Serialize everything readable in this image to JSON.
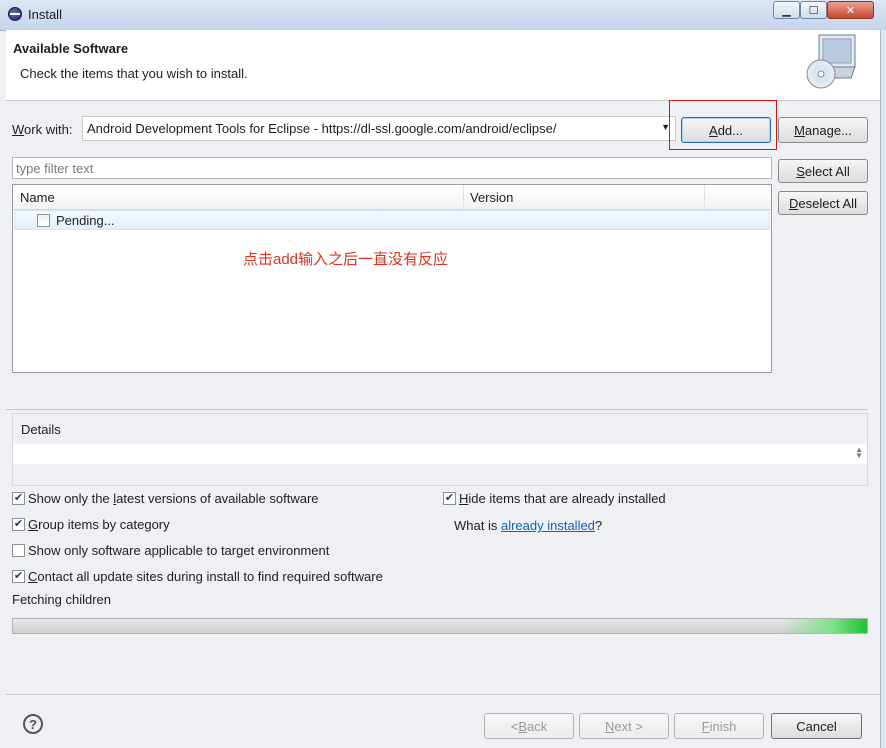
{
  "window": {
    "title": "Install"
  },
  "header": {
    "title": "Available Software",
    "description": "Check the items that you wish to install."
  },
  "work_with": {
    "label": "Work with:",
    "value": "Android Development Tools for Eclipse - https://dl-ssl.google.com/android/eclipse/",
    "add_label": "Add...",
    "manage_label": "Manage..."
  },
  "filter": {
    "placeholder": "type filter text"
  },
  "selection": {
    "select_all": "Select All",
    "deselect_all": "Deselect All"
  },
  "table": {
    "columns": [
      "Name",
      "Version"
    ],
    "rows": [
      {
        "name": "Pending..."
      }
    ]
  },
  "annotation": "点击add输入之后一直没有反应",
  "details": {
    "label": "Details"
  },
  "options": {
    "latest": {
      "label": "Show only the latest versions of available software",
      "checked": true
    },
    "group": {
      "label": "Group items by category",
      "checked": true
    },
    "target": {
      "label": "Show only software applicable to target environment",
      "checked": false
    },
    "contact": {
      "label": "Contact all update sites during install to find required software",
      "checked": true
    },
    "hide": {
      "label": "Hide items that are already installed",
      "checked": true
    }
  },
  "what_is": {
    "prefix": "What is ",
    "link": "already installed",
    "suffix": "?"
  },
  "status": "Fetching children",
  "progress": {
    "fraction": 1.0,
    "color": "#1bc42e"
  },
  "footer": {
    "back": "< Back",
    "next": "Next >",
    "finish": "Finish",
    "cancel": "Cancel"
  },
  "icons": {
    "window": "eclipse-icon",
    "header": "monitor-cd-icon",
    "help": "help-icon"
  }
}
